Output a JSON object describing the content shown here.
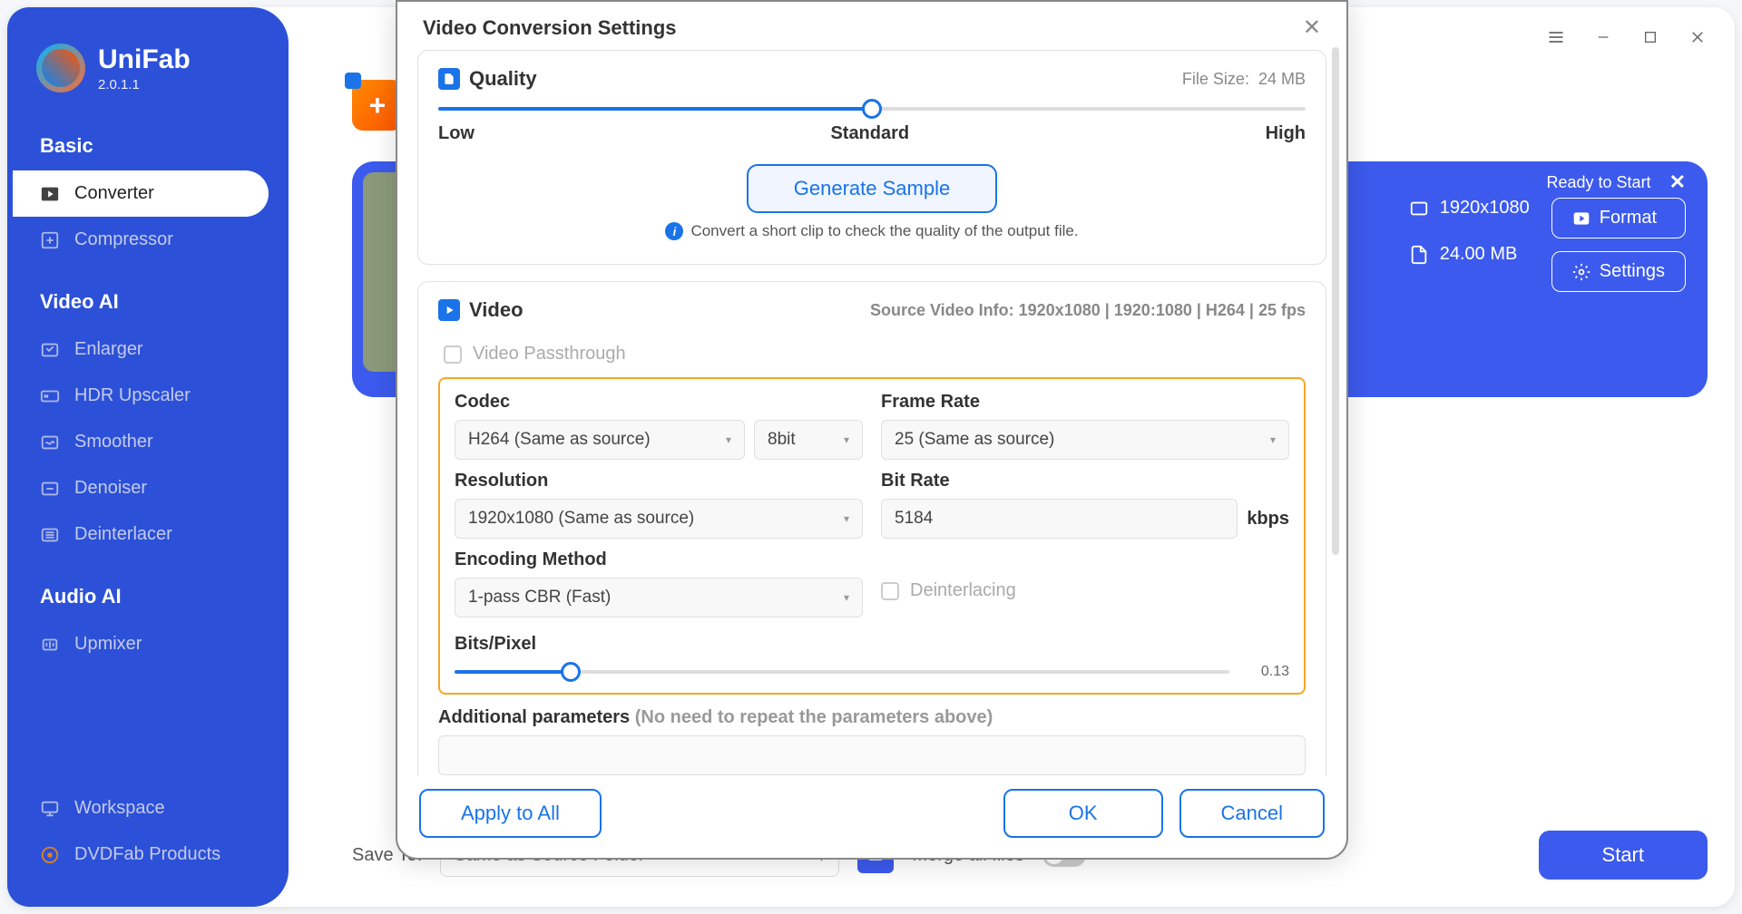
{
  "app": {
    "name": "UniFab",
    "version": "2.0.1.1"
  },
  "sidebar": {
    "sections": [
      {
        "header": "Basic",
        "items": [
          {
            "label": "Converter",
            "icon": "play-icon",
            "active": true
          },
          {
            "label": "Compressor",
            "icon": "compress-icon"
          }
        ]
      },
      {
        "header": "Video AI",
        "items": [
          {
            "label": "Enlarger",
            "icon": "enlarge-icon"
          },
          {
            "label": "HDR Upscaler",
            "icon": "hdr-icon"
          },
          {
            "label": "Smoother",
            "icon": "smooth-icon"
          },
          {
            "label": "Denoiser",
            "icon": "denoise-icon"
          },
          {
            "label": "Deinterlacer",
            "icon": "deinterlace-icon"
          }
        ]
      },
      {
        "header": "Audio AI",
        "items": [
          {
            "label": "Upmixer",
            "icon": "upmix-icon"
          }
        ]
      }
    ],
    "bottom": [
      {
        "label": "Workspace",
        "icon": "workspace-icon"
      },
      {
        "label": "DVDFab Products",
        "icon": "dvdfab-icon"
      }
    ]
  },
  "bg": {
    "ready": "Ready to Start",
    "resolution": "1920x1080",
    "size": "24.00 MB",
    "format_btn": "Format",
    "settings_btn": "Settings"
  },
  "bottom_bar": {
    "save_to_label": "Save To:",
    "save_to_value": "Same as Source Folder",
    "merge_label": "Merge all files",
    "start": "Start"
  },
  "modal": {
    "title": "Video Conversion Settings",
    "quality": {
      "title": "Quality",
      "file_size_label": "File Size:",
      "file_size": "24 MB",
      "low": "Low",
      "standard": "Standard",
      "high": "High",
      "generate": "Generate Sample",
      "info": "Convert a short clip to check the quality of the output file."
    },
    "video": {
      "title": "Video",
      "source_info": "Source Video Info: 1920x1080 | 1920:1080 | H264 | 25 fps",
      "passthrough": "Video Passthrough",
      "codec_label": "Codec",
      "codec": "H264 (Same as source)",
      "bitdepth": "8bit",
      "framerate_label": "Frame Rate",
      "framerate": "25 (Same as source)",
      "resolution_label": "Resolution",
      "resolution": "1920x1080 (Same as source)",
      "bitrate_label": "Bit Rate",
      "bitrate": "5184",
      "bitrate_unit": "kbps",
      "encoding_label": "Encoding Method",
      "encoding": "1-pass CBR (Fast)",
      "deinterlacing": "Deinterlacing",
      "bitspixel_label": "Bits/Pixel",
      "bitspixel": "0.13",
      "addl_label": "Additional parameters",
      "addl_hint": "(No need to repeat the parameters above)"
    },
    "footer": {
      "apply_all": "Apply to All",
      "ok": "OK",
      "cancel": "Cancel"
    }
  }
}
